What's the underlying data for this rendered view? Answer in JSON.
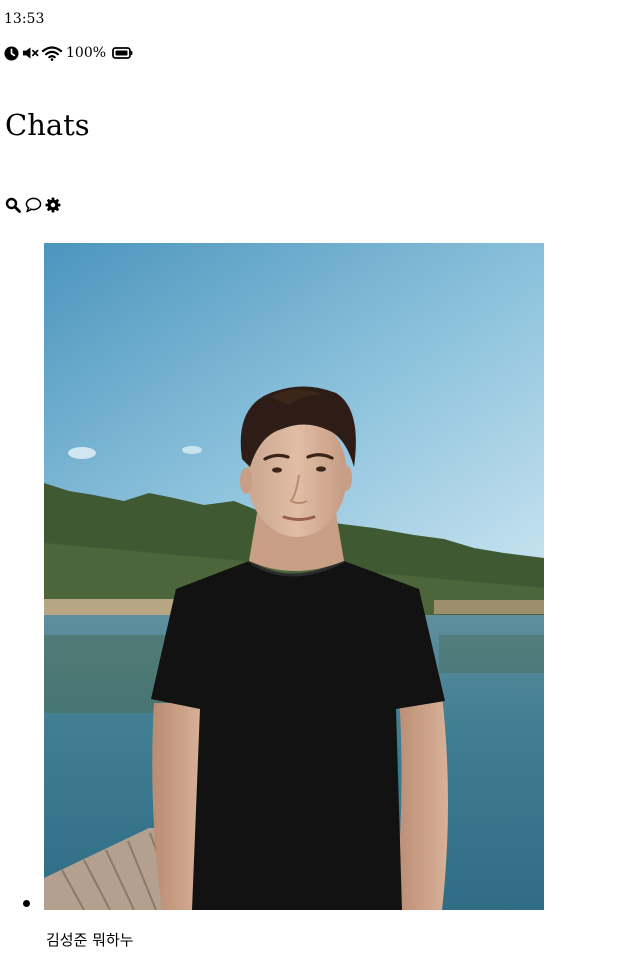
{
  "status_bar": {
    "time": "13:53",
    "battery_percent": "100%",
    "icons": [
      "alarm-clock-icon",
      "mute-icon",
      "wifi-icon",
      "battery-icon"
    ]
  },
  "header": {
    "title": "Chats"
  },
  "toolbar": {
    "icons": [
      "search-icon",
      "chat-bubble-icon",
      "settings-gear-icon"
    ]
  },
  "chats": [
    {
      "name": "김성준 뭐하누",
      "avatar": "profile-photo"
    }
  ]
}
